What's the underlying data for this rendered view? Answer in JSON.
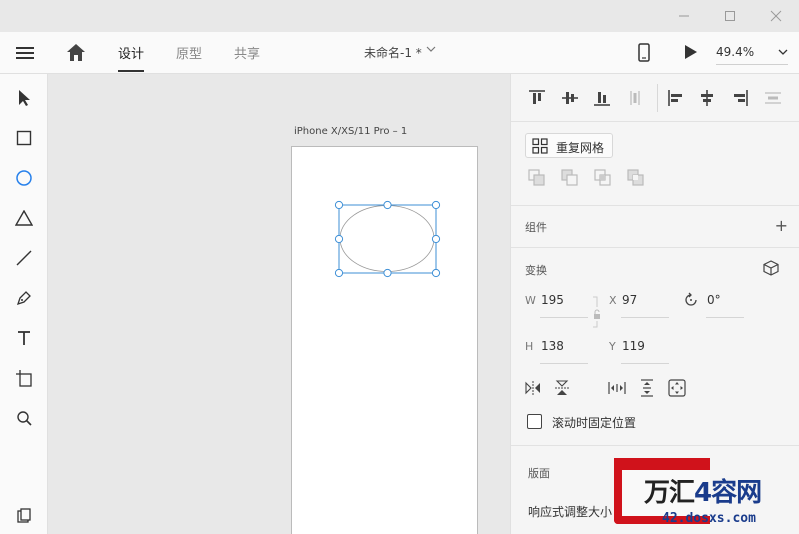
{
  "topbar": {
    "tabs": [
      {
        "label": "设计",
        "active": true
      },
      {
        "label": "原型",
        "active": false
      },
      {
        "label": "共享",
        "active": false
      }
    ],
    "document_name": "未命名-1 *",
    "zoom": "49.4%"
  },
  "toolbar": {
    "tools": [
      "select-tool",
      "rectangle-tool",
      "ellipse-tool",
      "polygon-tool",
      "line-tool",
      "pen-tool",
      "text-tool",
      "artboard-tool",
      "zoom-tool"
    ],
    "active_tool": "ellipse-tool"
  },
  "canvas": {
    "artboard_name": "iPhone X/XS/11 Pro – 1"
  },
  "panel": {
    "repeat_grid_label": "重复网格",
    "components_title": "组件",
    "components_add": "+",
    "transform": {
      "title": "变换",
      "w_label": "W",
      "w_value": "195",
      "x_label": "X",
      "x_value": "97",
      "rotation_value": "0°",
      "h_label": "H",
      "h_value": "138",
      "y_label": "Y",
      "y_value": "119"
    },
    "fixed_position_label": "滚动时固定位置",
    "fixed_position_checked": false,
    "layout": {
      "title": "版面",
      "responsive_label": "响应式调整大小"
    }
  },
  "watermark": {
    "brand_dark": "万汇",
    "brand_blue": "4容网",
    "url": "42.dosxs.com"
  },
  "colors": {
    "accent": "#2680eb",
    "selection": "#3d8fd6",
    "watermark_red": "#d0121b"
  }
}
